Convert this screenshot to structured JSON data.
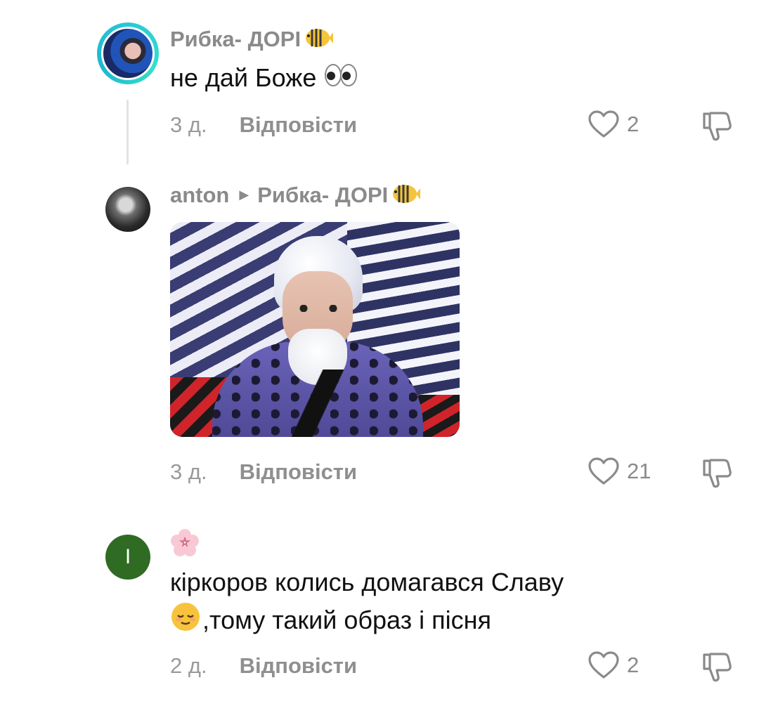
{
  "comments": [
    {
      "username": "Рибка- ДОРІ",
      "text": "не дай Боже",
      "time": "3 д.",
      "reply_label": "Відповісти",
      "likes": "2"
    },
    {
      "username": "anton",
      "reply_to": "Рибка- ДОРІ",
      "time": "3 д.",
      "reply_label": "Відповісти",
      "likes": "21"
    },
    {
      "avatar_letter": "I",
      "text_line1": "кіркоров колись домагався Славу",
      "text_line2": ",тому такий образ і пісня",
      "time": "2 д.",
      "reply_label": "Відповісти",
      "likes": "2"
    }
  ],
  "colors": {
    "accent_ring": "#27c8d6",
    "avatar_green": "#2f6b23",
    "muted_text": "#8a8a8a"
  },
  "icons": [
    "fish-emoji-icon",
    "eyes-emoji-icon",
    "heart-icon",
    "dislike-icon",
    "cherry-blossom-icon",
    "relieved-face-emoji-icon",
    "reply-arrow-icon"
  ]
}
